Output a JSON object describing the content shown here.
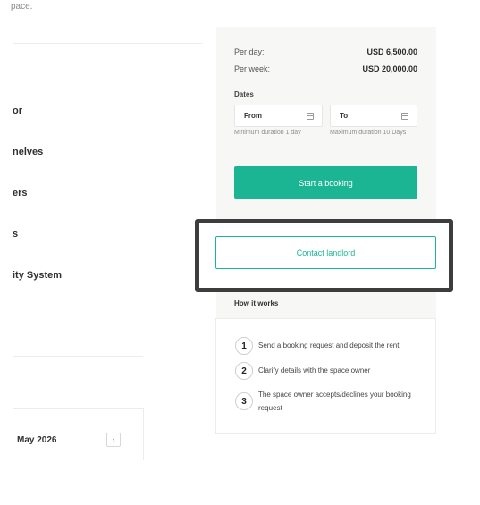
{
  "left": {
    "top_text": "pace.",
    "features": [
      "or",
      "nelves",
      "ers",
      "s",
      "ity System"
    ],
    "calendar": {
      "month": "May 2026",
      "next_icon": "chevron-right-icon"
    }
  },
  "booking": {
    "prices": [
      {
        "label": "Per day:",
        "value": "USD 6,500.00"
      },
      {
        "label": "Per week:",
        "value": "USD 20,000.00"
      }
    ],
    "dates_label": "Dates",
    "from_label": "From",
    "to_label": "To",
    "from_hint": "Minimum duration 1 day",
    "to_hint": "Maximum duration 10 Days",
    "start_button": "Start a booking",
    "contact_button": "Contact landlord"
  },
  "how_it_works": {
    "title": "How it works",
    "steps": [
      {
        "num": "1",
        "text": "Send a booking request and deposit the rent"
      },
      {
        "num": "2",
        "text": "Clarify details with the space owner"
      },
      {
        "num": "3",
        "text": "The space owner accepts/declines your booking request"
      }
    ]
  },
  "colors": {
    "accent": "#1cb593",
    "panel_bg": "#f7f7f5",
    "highlight_border": "#3d3d3d"
  }
}
